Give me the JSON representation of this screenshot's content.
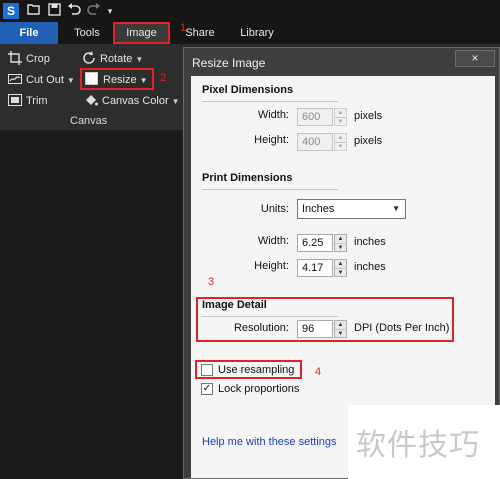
{
  "app": {
    "logo_letter": "S"
  },
  "quick_access": {
    "icons": [
      "open-folder-icon",
      "save-icon",
      "undo-icon",
      "redo-icon",
      "customize-dropdown-icon"
    ]
  },
  "tabs": [
    {
      "label": "File"
    },
    {
      "label": "Tools"
    },
    {
      "label": "Image"
    },
    {
      "label": "Share"
    },
    {
      "label": "Library"
    }
  ],
  "ribbon": {
    "crop": "Crop",
    "rotate": "Rotate",
    "cut_out": "Cut Out",
    "resize": "Resize",
    "trim": "Trim",
    "canvas_color": "Canvas Color",
    "group_label": "Canvas"
  },
  "annotations": {
    "one": "1",
    "two": "2",
    "three": "3",
    "four": "4",
    "color": "#e0232b"
  },
  "dialog": {
    "title": "Resize Image",
    "close": "×",
    "pixel_dimensions": {
      "title": "Pixel Dimensions",
      "width_label": "Width:",
      "width_value": "600",
      "height_label": "Height:",
      "height_value": "400",
      "unit": "pixels"
    },
    "print_dimensions": {
      "title": "Print Dimensions",
      "units_label": "Units:",
      "units_value": "Inches",
      "width_label": "Width:",
      "width_value": "6.25",
      "height_label": "Height:",
      "height_value": "4.17",
      "unit": "inches"
    },
    "image_detail": {
      "title": "Image Detail",
      "resolution_label": "Resolution:",
      "resolution_value": "96",
      "unit": "DPI (Dots Per Inch)"
    },
    "use_resampling": {
      "label": "Use resampling",
      "checked": false
    },
    "lock_proportions": {
      "label": "Lock proportions",
      "checked": true
    },
    "help_link": "Help me with these settings"
  },
  "watermark": "软件技巧",
  "colors": {
    "accent_blue": "#1f5fb4",
    "highlight_red": "#e0232b",
    "link": "#1a3fbf"
  }
}
